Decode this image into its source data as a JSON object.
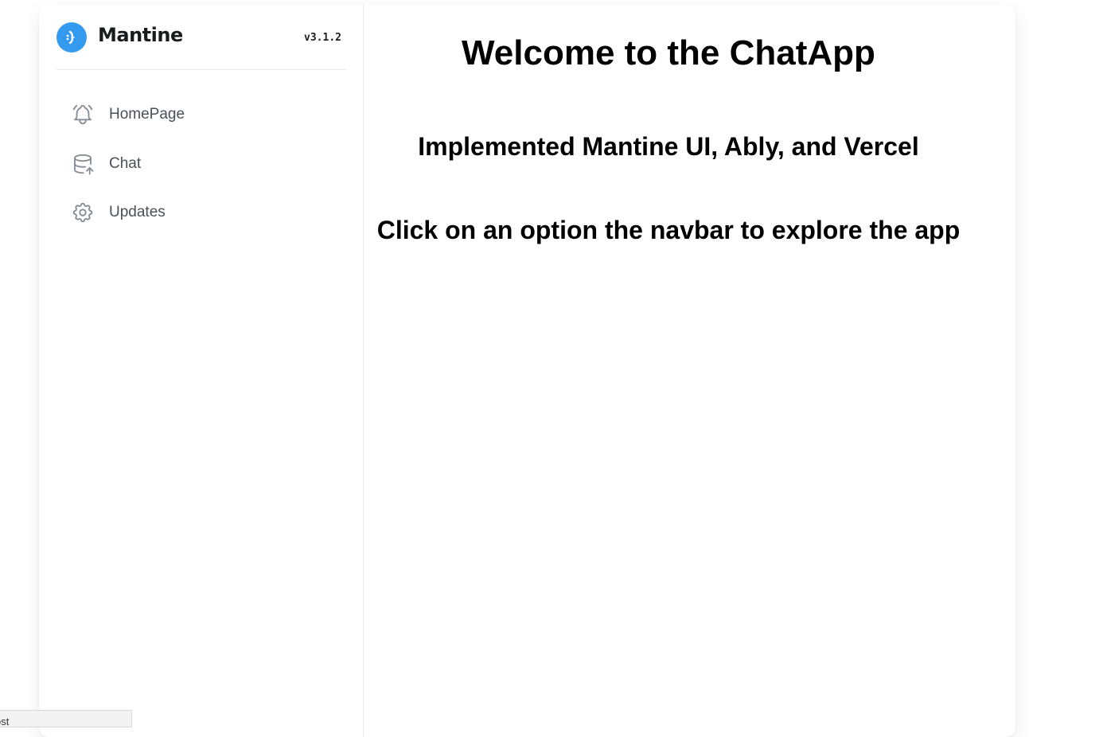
{
  "brand": {
    "name": "Mantine",
    "version": "v3.1.2",
    "logo_color": "#339af0"
  },
  "navbar": {
    "items": [
      {
        "label": "HomePage",
        "icon": "bell-ringing-icon"
      },
      {
        "label": "Chat",
        "icon": "database-import-icon"
      },
      {
        "label": "Updates",
        "icon": "settings-icon"
      }
    ]
  },
  "main": {
    "title": "Welcome to the ChatApp",
    "subtitle": "Implemented Mantine UI, Ably, and Vercel",
    "instruction": "Click on an option the navbar to explore the app"
  },
  "status_bar": {
    "text": "ost"
  }
}
